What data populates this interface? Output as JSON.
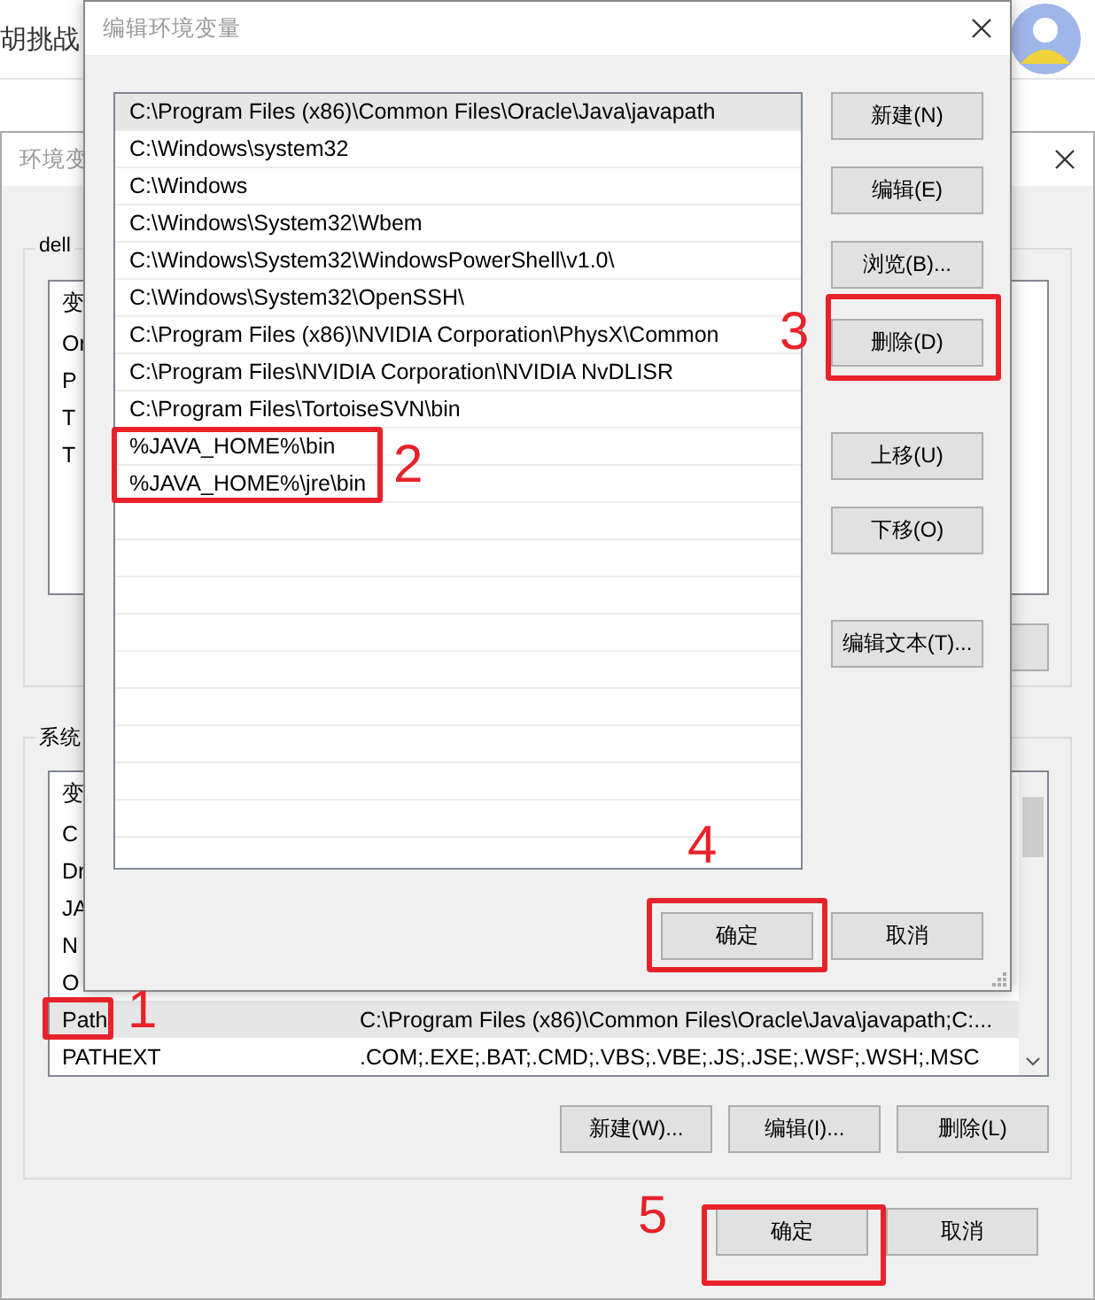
{
  "background_page": {
    "title_fragment": "胡挑战"
  },
  "env_window": {
    "title": "环境变",
    "user_group": {
      "label": "dell",
      "header": "变",
      "rows": [
        {
          "name": "Or",
          "selected": false
        },
        {
          "name": "P",
          "selected": false
        },
        {
          "name": "T",
          "selected": false
        },
        {
          "name": "T",
          "selected": false
        }
      ]
    },
    "system_group": {
      "label": "系统",
      "header": "变",
      "rows": [
        {
          "name": "C",
          "selected": false
        },
        {
          "name": "Dr",
          "selected": false
        },
        {
          "name": "JA",
          "selected": false
        },
        {
          "name": "N",
          "selected": false
        },
        {
          "name": "O",
          "selected": false
        },
        {
          "name": "Path",
          "value": "C:\\Program Files (x86)\\Common Files\\Oracle\\Java\\javapath;C:...",
          "selected": true
        },
        {
          "name": "PATHEXT",
          "value": ".COM;.EXE;.BAT;.CMD;.VBS;.VBE;.JS;.JSE;.WSF;.WSH;.MSC",
          "selected": false
        }
      ],
      "buttons": [
        "新建(W)...",
        "编辑(I)...",
        "删除(L)"
      ]
    },
    "buttons": [
      "确定",
      "取消"
    ]
  },
  "edit_dialog": {
    "title": "编辑环境变量",
    "entries": [
      {
        "text": "C:\\Program Files (x86)\\Common Files\\Oracle\\Java\\javapath",
        "selected": true
      },
      {
        "text": "C:\\Windows\\system32",
        "selected": false
      },
      {
        "text": "C:\\Windows",
        "selected": false
      },
      {
        "text": "C:\\Windows\\System32\\Wbem",
        "selected": false
      },
      {
        "text": "C:\\Windows\\System32\\WindowsPowerShell\\v1.0\\",
        "selected": false
      },
      {
        "text": "C:\\Windows\\System32\\OpenSSH\\",
        "selected": false
      },
      {
        "text": "C:\\Program Files (x86)\\NVIDIA Corporation\\PhysX\\Common",
        "selected": false
      },
      {
        "text": "C:\\Program Files\\NVIDIA Corporation\\NVIDIA NvDLISR",
        "selected": false
      },
      {
        "text": "C:\\Program Files\\TortoiseSVN\\bin",
        "selected": false
      },
      {
        "text": "%JAVA_HOME%\\bin",
        "selected": false
      },
      {
        "text": "%JAVA_HOME%\\jre\\bin",
        "selected": false
      }
    ],
    "side_buttons": [
      "新建(N)",
      "编辑(E)",
      "浏览(B)...",
      "删除(D)",
      "上移(U)",
      "下移(O)",
      "编辑文本(T)..."
    ],
    "buttons": [
      "确定",
      "取消"
    ]
  },
  "annotations": [
    "1",
    "2",
    "3",
    "4",
    "5"
  ]
}
